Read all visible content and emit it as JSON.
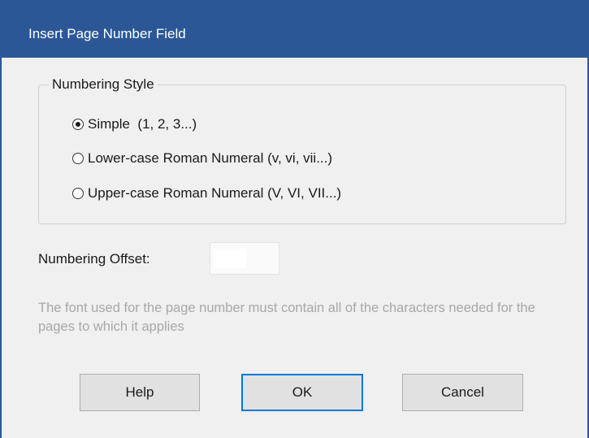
{
  "dialog": {
    "title": "Insert Page Number Field"
  },
  "numbering_style": {
    "legend": "Numbering Style",
    "options": [
      {
        "label": "Simple  (1, 2, 3...)",
        "selected": true
      },
      {
        "label": "Lower-case Roman Numeral (v, vi, vii...)",
        "selected": false
      },
      {
        "label": "Upper-case Roman Numeral (V, VI, VII...)",
        "selected": false
      }
    ]
  },
  "offset": {
    "label": "Numbering Offset:",
    "value": ""
  },
  "note": "The font used for the page number must contain all of the characters needed for the pages to which it applies",
  "buttons": {
    "help": "Help",
    "ok": "OK",
    "cancel": "Cancel"
  },
  "colors": {
    "titlebar": "#2b5797",
    "default_button_border": "#0078d7"
  }
}
